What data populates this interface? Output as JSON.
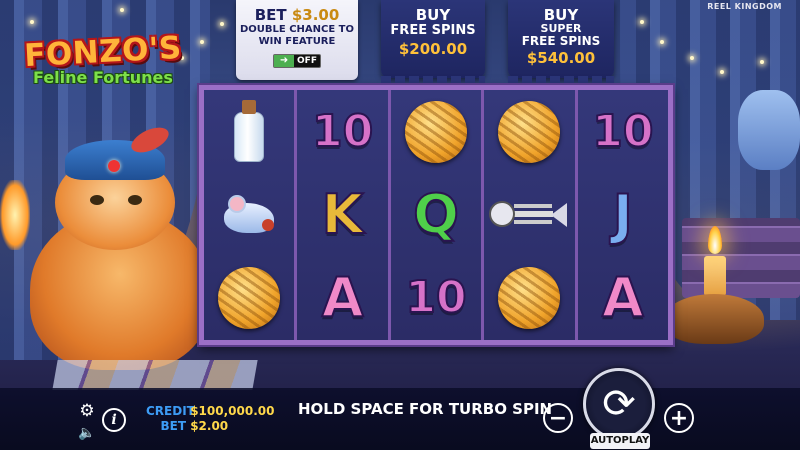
{
  "provider": "REEL KINGDOM",
  "logo": {
    "title": "FONZO'S",
    "subtitle": "Feline Fortunes"
  },
  "bet_feature": {
    "label": "BET",
    "amount": "$3.00",
    "description": "DOUBLE CHANCE TO WIN FEATURE",
    "toggle_state": "OFF"
  },
  "buy_free_spins": {
    "line1": "BUY",
    "line2": "FREE SPINS",
    "price": "$200.00"
  },
  "buy_super_free_spins": {
    "line1": "BUY",
    "line2": "SUPER",
    "line3": "FREE SPINS",
    "price": "$540.00"
  },
  "reels": [
    [
      {
        "symbol": "milk-bottle"
      },
      {
        "symbol": "toy-mouse"
      },
      {
        "symbol": "yarn-ball"
      }
    ],
    [
      {
        "symbol": "ten",
        "label": "10"
      },
      {
        "symbol": "king",
        "label": "K"
      },
      {
        "symbol": "ace",
        "label": "A"
      }
    ],
    [
      {
        "symbol": "yarn-ball"
      },
      {
        "symbol": "queen",
        "label": "Q"
      },
      {
        "symbol": "ten",
        "label": "10"
      }
    ],
    [
      {
        "symbol": "yarn-ball"
      },
      {
        "symbol": "fish-skeleton"
      },
      {
        "symbol": "yarn-ball"
      }
    ],
    [
      {
        "symbol": "ten",
        "label": "10"
      },
      {
        "symbol": "jack",
        "label": "J"
      },
      {
        "symbol": "ace",
        "label": "A"
      }
    ]
  ],
  "bottom_bar": {
    "credit_label": "CREDIT",
    "credit_value": "$100,000.00",
    "bet_label": "BET",
    "bet_value": "$2.00",
    "message": "HOLD SPACE FOR TURBO SPIN",
    "autoplay_label": "AUTOPLAY",
    "minus": "−",
    "plus": "+",
    "info": "i"
  },
  "colors": {
    "credit_label": "#3d9cf5",
    "credit_value": "#ffd84a",
    "reel_frame": "#9b6fc6",
    "banner_price": "#ffc13a"
  }
}
